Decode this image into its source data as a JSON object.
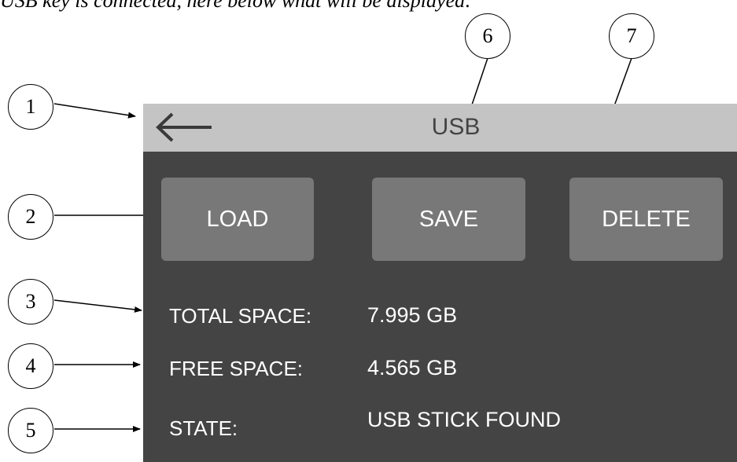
{
  "document": {
    "intro_text": "USB key is connected, here below what will be displayed:"
  },
  "callouts": [
    "1",
    "2",
    "3",
    "4",
    "5",
    "6",
    "7"
  ],
  "screen": {
    "title": "USB",
    "buttons": {
      "load": "LOAD",
      "save": "SAVE",
      "delete": "DELETE"
    },
    "info": {
      "total_label": "TOTAL SPACE:",
      "total_value": "7.995 GB",
      "free_label": "FREE SPACE:",
      "free_value": "4.565 GB",
      "state_label": "STATE:",
      "state_value": "USB STICK FOUND"
    }
  },
  "colors": {
    "topbar": "#c4c4c4",
    "background": "#444444",
    "button": "#787878",
    "text": "#ffffff"
  },
  "icons": {
    "back": "arrow-left-icon"
  }
}
